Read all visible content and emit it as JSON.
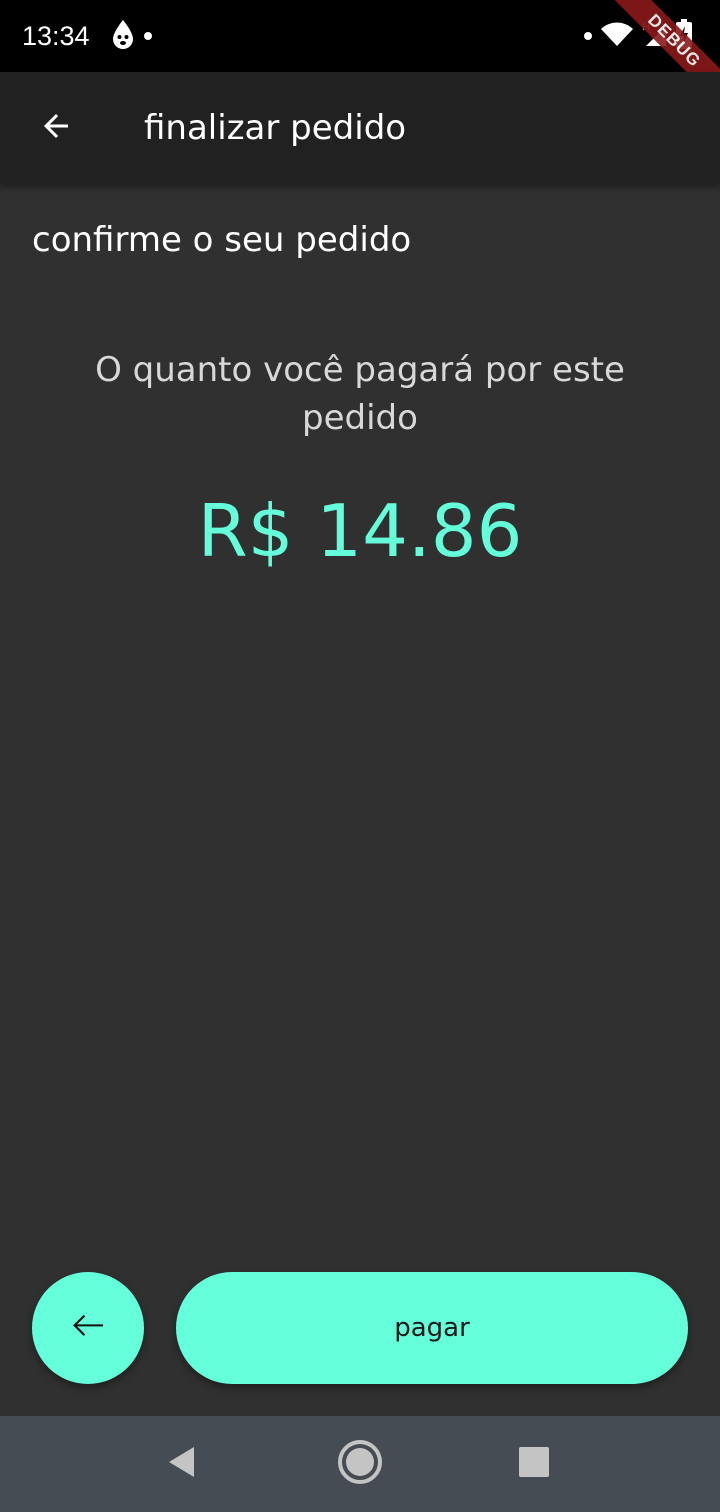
{
  "status_bar": {
    "time": "13:34",
    "icons": [
      "drop-notification-icon",
      "dot-icon",
      "wifi-icon",
      "signal-icon",
      "battery-charging-icon"
    ]
  },
  "debug_banner": {
    "label": "DEBUG"
  },
  "app_bar": {
    "back_icon": "arrow-back-icon",
    "title": "finalizar pedido"
  },
  "content": {
    "section_title": "confirme o seu pedido",
    "amount_caption": "O quanto você pagará por este pedido",
    "amount_value": "R$ 14.86"
  },
  "actions": {
    "back_icon": "arrow-back-icon",
    "pay_label": "pagar"
  },
  "nav_bar": {
    "icons": [
      "back-triangle-icon",
      "home-circle-icon",
      "recents-square-icon"
    ]
  },
  "colors": {
    "accent": "#64ffda",
    "background": "#303030",
    "app_bar": "#212121",
    "nav_bar": "#454c54",
    "debug_ribbon": "#8b1a1a"
  }
}
